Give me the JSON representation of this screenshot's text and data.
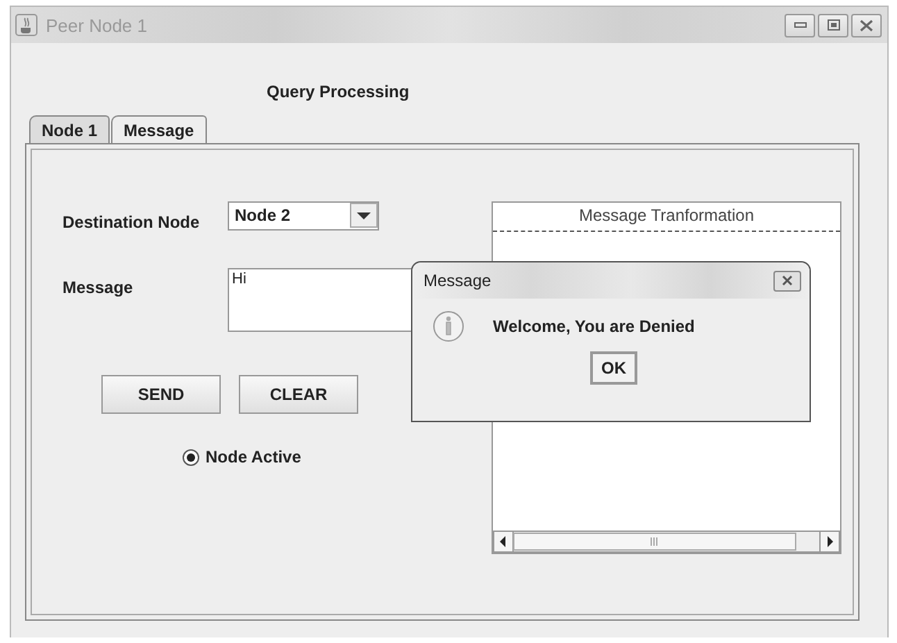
{
  "window": {
    "title": "Peer Node 1"
  },
  "heading": "Query Processing",
  "tabs": [
    {
      "label": "Node 1",
      "selected": true
    },
    {
      "label": "Message",
      "selected": false
    }
  ],
  "form": {
    "destination_label": "Destination Node",
    "destination_value": "Node 2",
    "message_label": "Message",
    "message_value": "Hi",
    "buttons": [
      "SEND",
      "CLEAR"
    ],
    "radio": {
      "label": "Node Active",
      "selected": true
    }
  },
  "transformation_panel": {
    "title": "Message Tranformation"
  },
  "dialog": {
    "title": "Message",
    "text": "Welcome, You are Denied",
    "button": "OK"
  }
}
